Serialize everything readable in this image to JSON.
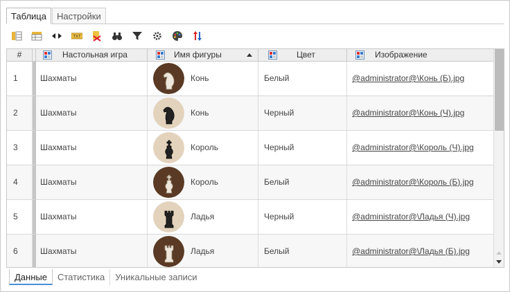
{
  "top_tabs": [
    {
      "label": "Таблица",
      "active": true
    },
    {
      "label": "Настройки",
      "active": false
    }
  ],
  "toolbar": {
    "icons": [
      "columns-icon",
      "table-options-icon",
      "expand-columns-icon",
      "text-export-icon",
      "excel-export-icon",
      "binoculars-icon",
      "filter-icon",
      "gear-icon",
      "palette-icon",
      "sort-icon"
    ]
  },
  "grid": {
    "columns": [
      {
        "label": "#"
      },
      {
        "label": "Настольная игра"
      },
      {
        "label": "Имя фигуры",
        "sorted": "ascending"
      },
      {
        "label": "Цвет"
      },
      {
        "label": "Изображение"
      }
    ],
    "rows": [
      {
        "num": "1",
        "game": "Шахматы",
        "figure": "Конь",
        "color": "Белый",
        "image": "@administrator@\\Конь (Б).jpg",
        "piece": "knight",
        "piece_color": "white"
      },
      {
        "num": "2",
        "game": "Шахматы",
        "figure": "Конь",
        "color": "Черный",
        "image": "@administrator@\\Конь (Ч).jpg",
        "piece": "knight",
        "piece_color": "black"
      },
      {
        "num": "3",
        "game": "Шахматы",
        "figure": "Король",
        "color": "Черный",
        "image": "@administrator@\\Король (Ч).jpg",
        "piece": "king",
        "piece_color": "black"
      },
      {
        "num": "4",
        "game": "Шахматы",
        "figure": "Король",
        "color": "Белый",
        "image": "@administrator@\\Король (Б).jpg",
        "piece": "king",
        "piece_color": "white"
      },
      {
        "num": "5",
        "game": "Шахматы",
        "figure": "Ладья",
        "color": "Черный",
        "image": "@administrator@\\Ладья (Ч).jpg",
        "piece": "rook",
        "piece_color": "black"
      },
      {
        "num": "6",
        "game": "Шахматы",
        "figure": "Ладья",
        "color": "Белый",
        "image": "@administrator@\\Ладья (Б).jpg",
        "piece": "rook",
        "piece_color": "white"
      }
    ]
  },
  "bottom_tabs": [
    {
      "label": "Данные",
      "active": true
    },
    {
      "label": "Статистика",
      "active": false
    },
    {
      "label": "Уникальные записи",
      "active": false
    }
  ],
  "colors": {
    "accent": "#4a8fd6",
    "header_bg": "#eeeeee",
    "border": "#c8c8c8"
  }
}
